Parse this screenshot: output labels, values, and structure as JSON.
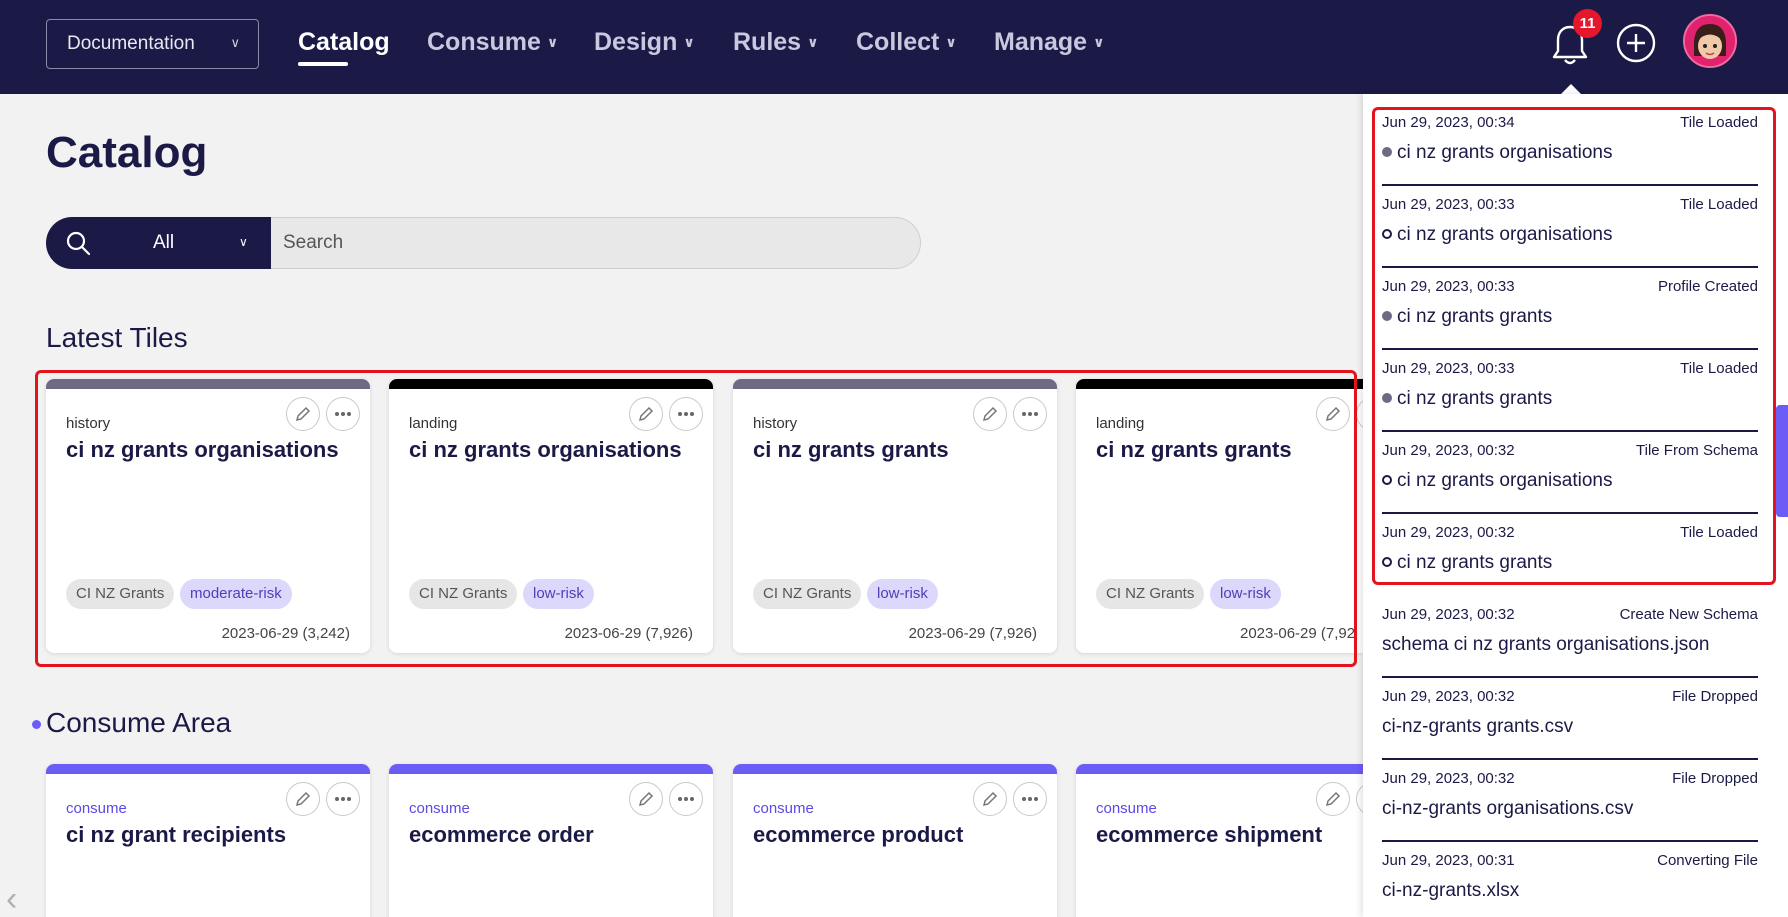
{
  "header": {
    "doc_select": "Documentation",
    "nav": [
      {
        "label": "Catalog",
        "active": true
      },
      {
        "label": "Consume"
      },
      {
        "label": "Design"
      },
      {
        "label": "Rules"
      },
      {
        "label": "Collect"
      },
      {
        "label": "Manage"
      }
    ],
    "notification_count": "11"
  },
  "main": {
    "title": "Catalog",
    "search": {
      "scope": "All",
      "placeholder": "Search"
    },
    "latest_title": "Latest Tiles",
    "consume_title": "Consume Area",
    "latest_tiles": [
      {
        "kind": "history",
        "name": "ci nz grants organisations",
        "tags": [
          "CI NZ Grants",
          "moderate-risk"
        ],
        "meta": "2023-06-29 (3,242)",
        "strip": "#6d6a85"
      },
      {
        "kind": "landing",
        "name": "ci nz grants organisations",
        "tags": [
          "CI NZ Grants",
          "low-risk"
        ],
        "meta": "2023-06-29 (7,926)",
        "strip": "#000000"
      },
      {
        "kind": "history",
        "name": "ci nz grants grants",
        "tags": [
          "CI NZ Grants",
          "low-risk"
        ],
        "meta": "2023-06-29 (7,926)",
        "strip": "#6d6a85"
      },
      {
        "kind": "landing",
        "name": "ci nz grants grants",
        "tags": [
          "CI NZ Grants",
          "low-risk"
        ],
        "meta": "2023-06-29 (7,92",
        "strip": "#000000"
      }
    ],
    "consume_tiles": [
      {
        "kind": "consume",
        "name": "ci nz grant recipients"
      },
      {
        "kind": "consume",
        "name": "ecommerce order"
      },
      {
        "kind": "consume",
        "name": "ecommerce product"
      },
      {
        "kind": "consume",
        "name": "ecommerce shipment"
      }
    ],
    "consume_strip": "#6b5cf6"
  },
  "notifications": [
    {
      "date": "Jun 29, 2023, 00:34",
      "event": "Tile Loaded",
      "title": "ci nz grants organisations",
      "dot": "filled"
    },
    {
      "date": "Jun 29, 2023, 00:33",
      "event": "Tile Loaded",
      "title": "ci nz grants organisations",
      "dot": "hollow"
    },
    {
      "date": "Jun 29, 2023, 00:33",
      "event": "Profile Created",
      "title": "ci nz grants grants",
      "dot": "filled"
    },
    {
      "date": "Jun 29, 2023, 00:33",
      "event": "Tile Loaded",
      "title": "ci nz grants grants",
      "dot": "filled"
    },
    {
      "date": "Jun 29, 2023, 00:32",
      "event": "Tile From Schema",
      "title": "ci nz grants organisations",
      "dot": "hollow"
    },
    {
      "date": "Jun 29, 2023, 00:32",
      "event": "Tile Loaded",
      "title": "ci nz grants grants",
      "dot": "hollow"
    },
    {
      "date": "Jun 29, 2023, 00:32",
      "event": "Create New Schema",
      "title": "schema ci nz grants organisations.json",
      "dot": "none"
    },
    {
      "date": "Jun 29, 2023, 00:32",
      "event": "File Dropped",
      "title": "ci-nz-grants grants.csv",
      "dot": "none"
    },
    {
      "date": "Jun 29, 2023, 00:32",
      "event": "File Dropped",
      "title": "ci-nz-grants organisations.csv",
      "dot": "none"
    },
    {
      "date": "Jun 29, 2023, 00:31",
      "event": "Converting File",
      "title": "ci-nz-grants.xlsx",
      "dot": "none"
    }
  ],
  "colors": {
    "navy": "#1b1a47",
    "accent": "#6b5cf6",
    "highlight": "#e3141e",
    "badge": "#e6172a"
  },
  "icons": [
    "chevron-down-icon",
    "bell-icon",
    "plus-circle-icon",
    "search-icon",
    "pencil-icon",
    "more-icon",
    "chevron-left-icon"
  ]
}
